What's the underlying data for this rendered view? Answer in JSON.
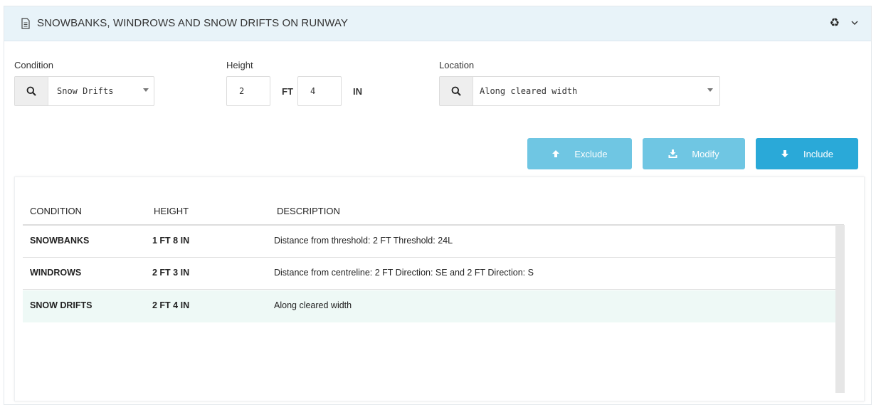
{
  "header": {
    "title": "SNOWBANKS, WINDROWS AND SNOW DRIFTS ON RUNWAY"
  },
  "form": {
    "condition_label": "Condition",
    "condition_value": "Snow Drifts",
    "height_label": "Height",
    "height_ft_value": "2",
    "height_ft_unit": "FT",
    "height_in_value": "4",
    "height_in_unit": "IN",
    "location_label": "Location",
    "location_value": "Along cleared width"
  },
  "buttons": {
    "exclude": "Exclude",
    "modify": "Modify",
    "include": "Include"
  },
  "table": {
    "columns": [
      "CONDITION",
      "HEIGHT",
      "DESCRIPTION"
    ],
    "rows": [
      {
        "condition": "SNOWBANKS",
        "height": "1 FT 8 IN",
        "description": "Distance from threshold: 2 FT Threshold: 24L"
      },
      {
        "condition": "WINDROWS",
        "height": "2 FT 3 IN",
        "description": "Distance from centreline: 2 FT Direction: SE and 2 FT Direction: S"
      },
      {
        "condition": "SNOW DRIFTS",
        "height": "2 FT 4 IN",
        "description": "Along cleared width"
      }
    ]
  },
  "colors": {
    "header_bg": "#e8f3f9",
    "button_light": "#6fc6e3",
    "button_primary": "#2aa9d8",
    "selected_row": "#eef9f6"
  },
  "icons": {
    "header": "document-icon",
    "reset": "recycle-icon",
    "collapse": "chevron-down-icon",
    "search": "search-icon",
    "exclude": "arrow-up-icon",
    "modify": "download-icon",
    "include": "arrow-down-icon"
  }
}
